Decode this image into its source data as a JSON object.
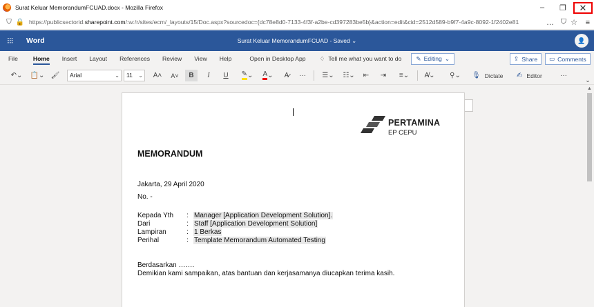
{
  "browser": {
    "window_title": "Surat Keluar MemorandumFCUAD.docx - Mozilla Firefox",
    "url_prefix": "https://publicsectorid.",
    "url_domain": "sharepoint.com",
    "url_rest": "/:w:/r/sites/ecm/_layouts/15/Doc.aspx?sourcedoc={dc78e8d0-7133-4f3f-a2be-cd397283be5b}&action=edit&cid=2512d589-b9f7-4a9c-8092-1f2402e81",
    "more_icon": "…",
    "window_controls": {
      "minimize": "–",
      "maximize": "❐",
      "close": "✕"
    }
  },
  "word": {
    "app_name": "Word",
    "doc_status": "Surat Keluar MemorandumFCUAD  -  Saved ⌄",
    "avatar": "👤"
  },
  "ribbon": {
    "tabs": [
      "File",
      "Home",
      "Insert",
      "Layout",
      "References",
      "Review",
      "View",
      "Help"
    ],
    "open_desktop": "Open in Desktop App",
    "tell_me": "Tell me what you want to do",
    "editing": "Editing",
    "share": "Share",
    "comments": "Comments"
  },
  "toolbar": {
    "font_name": "Arial",
    "font_size": "11",
    "dictate": "Dictate",
    "editor": "Editor",
    "more": "···"
  },
  "document": {
    "logo_name": "PERTAMINA",
    "logo_sub": "EP CEPU",
    "title": "MEMORANDUM",
    "place_date": "Jakarta, 29 April 2020",
    "number": "No. -",
    "fields": [
      {
        "label": "Kepada  Yth",
        "value": "Manager [Application Development Solution]."
      },
      {
        "label": "Dari",
        "value": "Staff [Application Development Solution]"
      },
      {
        "label": "Lampiran",
        "value": "1 Berkas"
      },
      {
        "label": "Perihal",
        "value": "Template Memorandum Automated Testing"
      }
    ],
    "colon": ":",
    "body_1": "Berdasarkan …….",
    "body_2": "Demikian kami sampaikan, atas bantuan dan kerjasamanya diucapkan terima kasih."
  }
}
